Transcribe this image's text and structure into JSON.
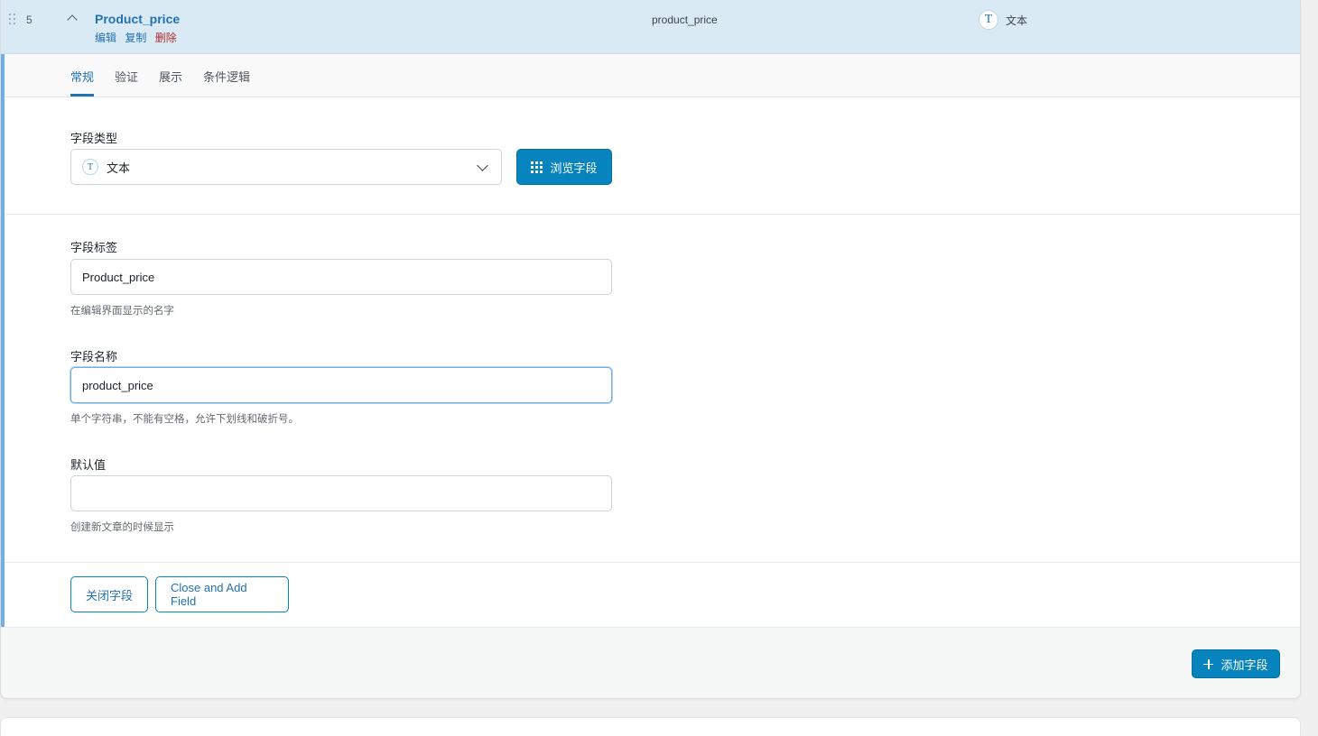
{
  "field_row": {
    "order": "5",
    "title": "Product_price",
    "actions": {
      "edit": "编辑",
      "duplicate": "复制",
      "delete": "删除"
    },
    "name": "product_price",
    "type_icon": "T",
    "type_label": "文本"
  },
  "tabs": [
    "常规",
    "验证",
    "展示",
    "条件逻辑"
  ],
  "active_tab": "常规",
  "field_type": {
    "label": "字段类型",
    "icon": "T",
    "value": "文本",
    "browse_label": "浏览字段"
  },
  "field_label": {
    "label": "字段标签",
    "value": "Product_price",
    "help": "在编辑界面显示的名字"
  },
  "field_name": {
    "label": "字段名称",
    "value": "product_price",
    "help": "单个字符串，不能有空格，允许下划线和破折号。"
  },
  "default_value": {
    "label": "默认值",
    "value": "",
    "help": "创建新文章的时候显示"
  },
  "buttons": {
    "close_field": "关闭字段",
    "close_and_add": "Close and Add Field",
    "add_field": "添加字段"
  },
  "colors": {
    "accent": "#2271b1",
    "primary_button": "#0783be",
    "delete": "#b32d2e",
    "row_highlight": "#d9eaf5"
  }
}
